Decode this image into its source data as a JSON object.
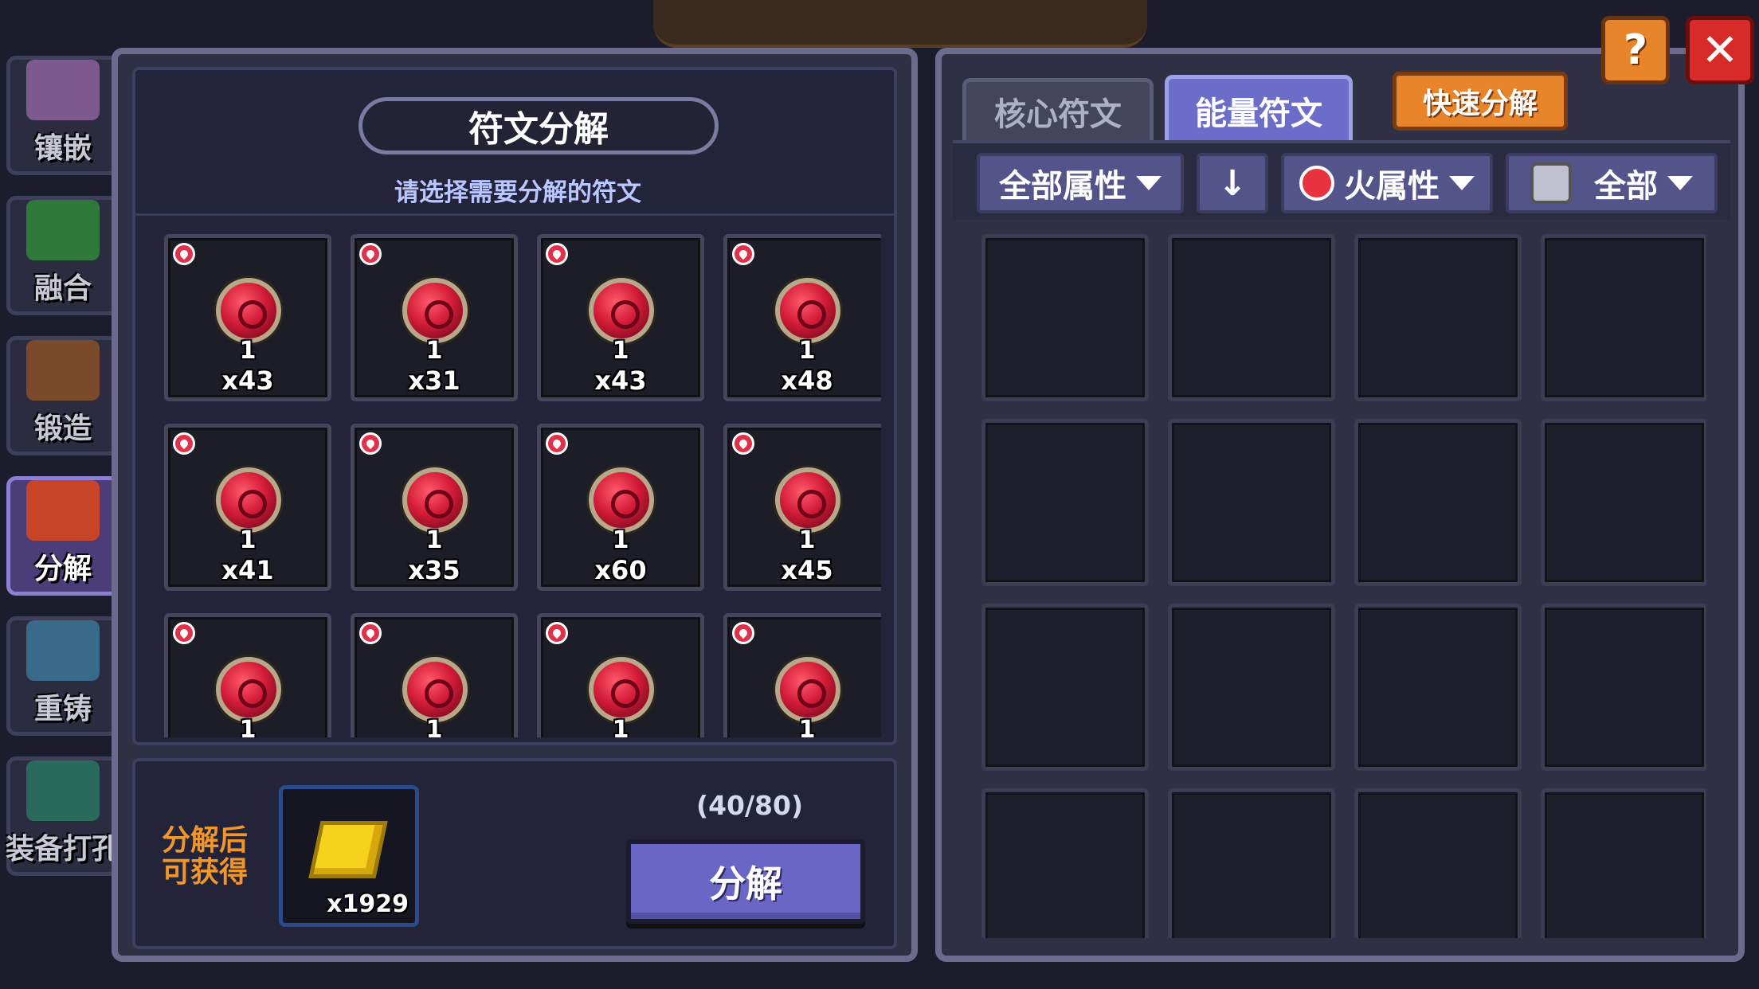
{
  "sidebar": {
    "items": [
      {
        "label": "镶嵌",
        "icon": "inlay-icon",
        "color": "#7c5a8e"
      },
      {
        "label": "融合",
        "icon": "fusion-icon",
        "color": "#2f7a3a"
      },
      {
        "label": "锻造",
        "icon": "forge-icon",
        "color": "#7a4a2a"
      },
      {
        "label": "分解",
        "icon": "decompose-icon",
        "color": "#c8452a",
        "active": true
      },
      {
        "label": "重铸",
        "icon": "recast-icon",
        "color": "#3a6a8a"
      },
      {
        "label": "装备打孔",
        "icon": "socket-punch-icon",
        "color": "#2a6a5a"
      }
    ]
  },
  "left_panel": {
    "title": "符文分解",
    "subtitle": "请选择需要分解的符文",
    "runes": [
      {
        "level": "1",
        "qty": "x43"
      },
      {
        "level": "1",
        "qty": "x31"
      },
      {
        "level": "1",
        "qty": "x43"
      },
      {
        "level": "1",
        "qty": "x48"
      },
      {
        "level": "1",
        "qty": "x41"
      },
      {
        "level": "1",
        "qty": "x35"
      },
      {
        "level": "1",
        "qty": "x60"
      },
      {
        "level": "1",
        "qty": "x45"
      },
      {
        "level": "1",
        "qty": ""
      },
      {
        "level": "1",
        "qty": ""
      },
      {
        "level": "1",
        "qty": ""
      },
      {
        "level": "1",
        "qty": ""
      }
    ],
    "gain_label": "分解后可获得",
    "reward_qty": "x1929",
    "capacity": "(40/80)",
    "decompose_button": "分解"
  },
  "right_panel": {
    "tabs": [
      "核心符文",
      "能量符文"
    ],
    "active_tab": "能量符文",
    "quick_decompose": "快速分解",
    "filters": {
      "attribute": "全部属性",
      "sort": "↓",
      "element": "火属性",
      "category": "全部"
    },
    "slot_count": 16
  },
  "top_buttons": {
    "help": "?",
    "close": "✕"
  },
  "colors": {
    "accent": "#6a66c6",
    "orange": "#e8842a",
    "rune_red": "#d41c38",
    "close_red": "#d92a2a"
  }
}
